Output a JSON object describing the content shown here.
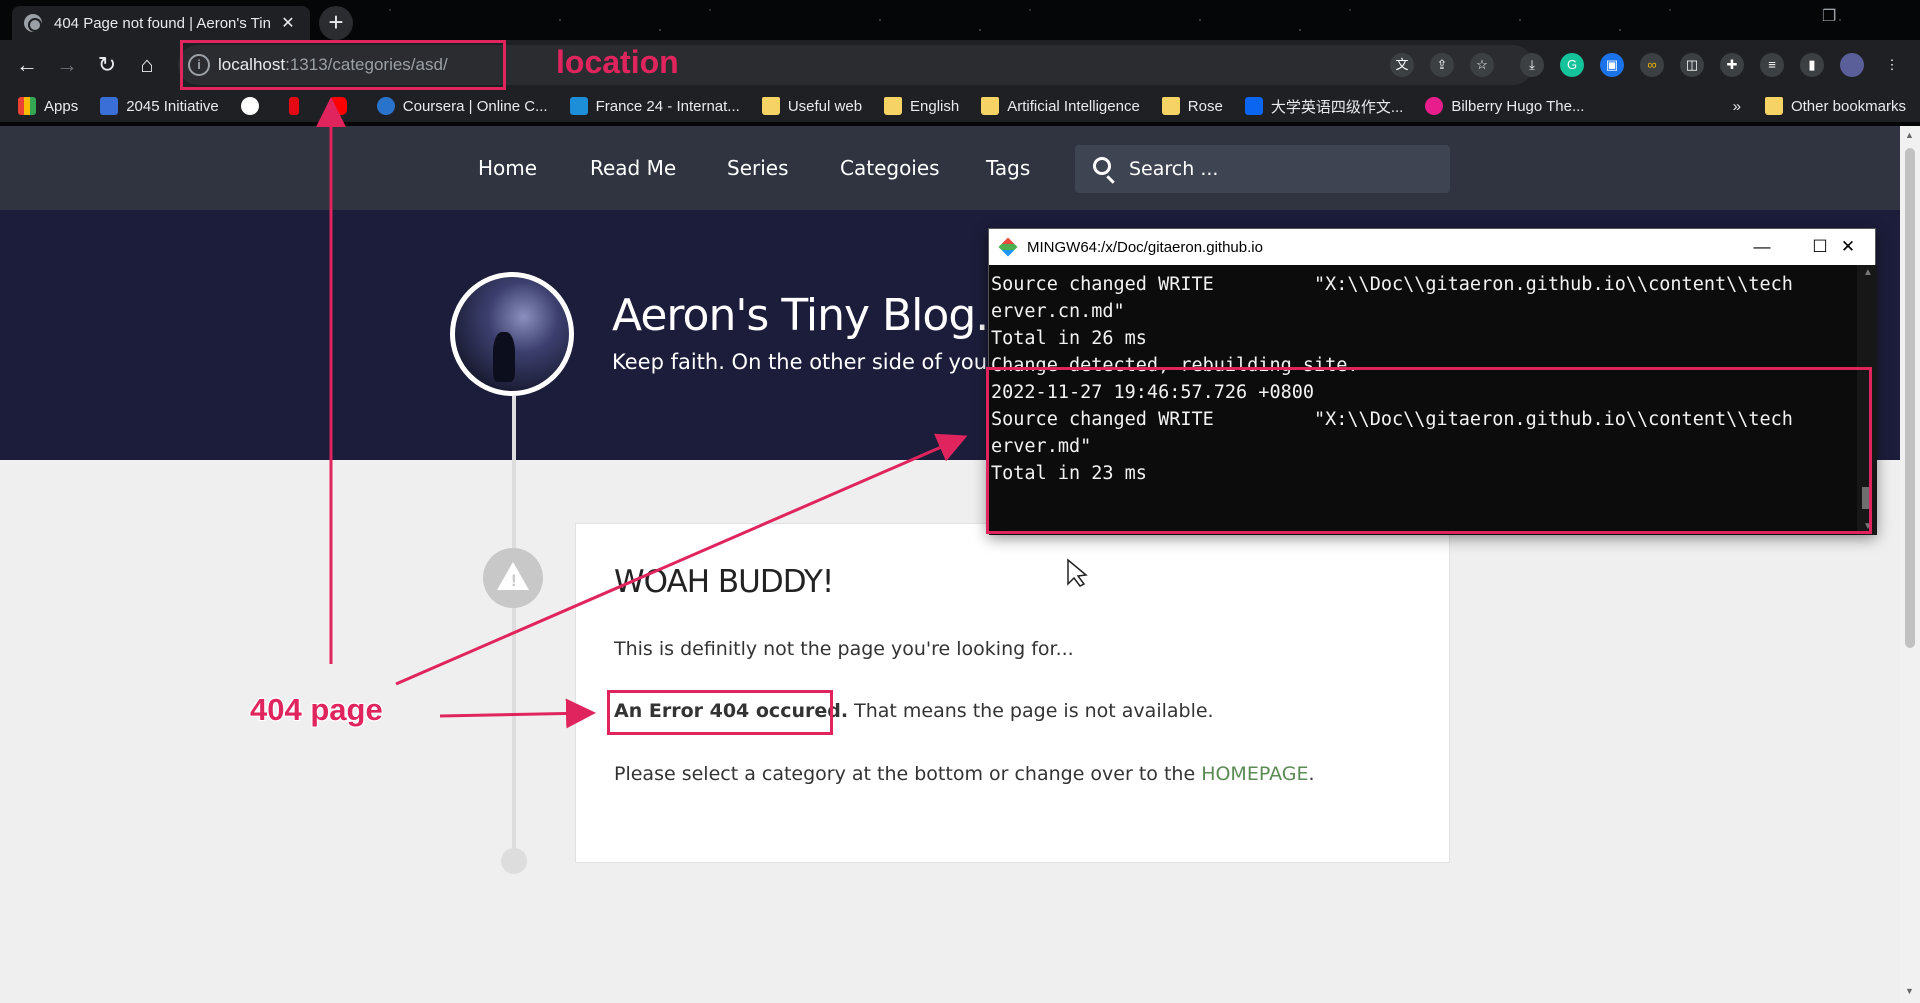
{
  "browser": {
    "tab_title": "404 Page not found | Aeron's Tin",
    "tab_close": "✕",
    "new_tab": "+",
    "url_host": "localhost",
    "url_path": ":1313/categories/asd/",
    "bookmarks": [
      {
        "label": "Apps",
        "icon": "apps-grid-icon",
        "color": "#4285f4"
      },
      {
        "label": "2045 Initiative",
        "icon": "bookmark-2045-icon",
        "color": "#3b6fd8"
      },
      {
        "label": "",
        "icon": "google-icon",
        "color": "#ffffff"
      },
      {
        "label": "",
        "icon": "netflix-icon",
        "color": "#e50914"
      },
      {
        "label": "",
        "icon": "youtube-icon",
        "color": "#ff0000"
      },
      {
        "label": "Coursera | Online C...",
        "icon": "coursera-icon",
        "color": "#2a73cc"
      },
      {
        "label": "France 24 - Internat...",
        "icon": "france24-icon",
        "color": "#1d8fd8"
      },
      {
        "label": "Useful web",
        "icon": "folder-icon",
        "color": "#f6d365"
      },
      {
        "label": "English",
        "icon": "folder-icon",
        "color": "#f6d365"
      },
      {
        "label": "Artificial Intelligence",
        "icon": "folder-icon",
        "color": "#f6d365"
      },
      {
        "label": "Rose",
        "icon": "folder-icon",
        "color": "#f6d365"
      },
      {
        "label": "大学英语四级作文...",
        "icon": "zhihu-icon",
        "color": "#0a66f0"
      },
      {
        "label": "Bilberry Hugo The...",
        "icon": "hugo-icon",
        "color": "#e91e8c"
      }
    ],
    "more_bookmarks": "»",
    "other_bookmarks": "Other bookmarks"
  },
  "site": {
    "nav": [
      "Home",
      "Read Me",
      "Series",
      "Categoies",
      "Tags"
    ],
    "search_placeholder": "Search ...",
    "blog_title": "Aeron's Tiny Blog.",
    "blog_subtitle": "Keep faith. On the other side of your",
    "card": {
      "heading": "WOAH BUDDY!",
      "line1": "This is definitly not the page you're looking for...",
      "error_bold": "An Error 404 occured.",
      "error_rest": " That means the page is not available.",
      "line3_prefix": "Please select a category at the bottom or change over to the ",
      "homepage_link": "HOMEPAGE",
      "line3_suffix": "."
    }
  },
  "terminal": {
    "title": "MINGW64:/x/Doc/gitaeron.github.io",
    "lines": [
      "Source changed WRITE         \"X:\\\\Doc\\\\gitaeron.github.io\\\\content\\\\tech",
      "erver.cn.md\"",
      "Total in 26 ms",
      "",
      "Change detected, rebuilding site.",
      "2022-11-27 19:46:57.726 +0800",
      "Source changed WRITE         \"X:\\\\Doc\\\\gitaeron.github.io\\\\content\\\\tech",
      "erver.md\"",
      "Total in 23 ms"
    ]
  },
  "annotations": {
    "location_label": "location",
    "page404_label": "404 page",
    "color": "#e0245e"
  }
}
